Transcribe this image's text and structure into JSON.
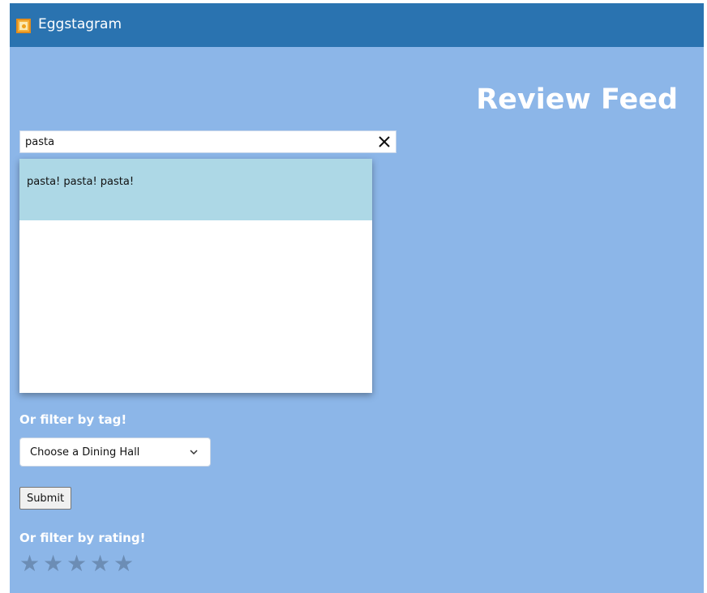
{
  "app": {
    "title": "Eggstagram"
  },
  "page": {
    "title": "Review Feed"
  },
  "search": {
    "value": "pasta",
    "suggestions": [
      "pasta! pasta! pasta!"
    ]
  },
  "tag_filter": {
    "label": "Or filter by tag!",
    "selected": "Choose a Dining Hall"
  },
  "submit": {
    "label": "Submit"
  },
  "rating_filter": {
    "label": "Or filter by rating!",
    "max_stars": 5,
    "selected_stars": 0
  },
  "colors": {
    "titlebar": "#2a73b0",
    "background": "#8cb6e8",
    "suggestion_highlight": "#add8e6",
    "star": "#6c8db5"
  }
}
